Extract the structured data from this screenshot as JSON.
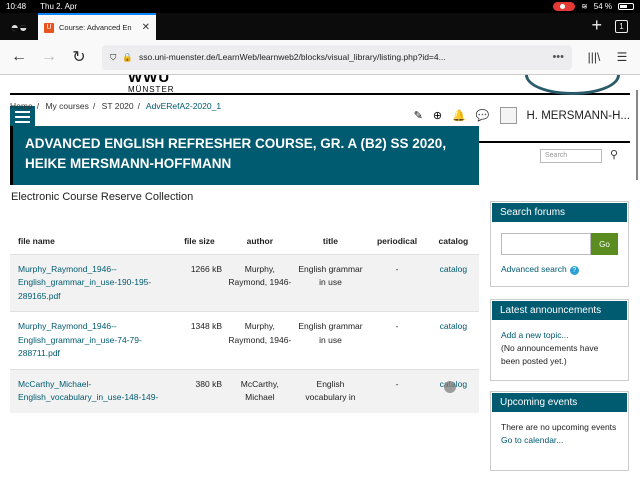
{
  "status_bar": {
    "time": "10:48",
    "date": "Thu 2. Apr",
    "battery": "54 %"
  },
  "browser": {
    "tab_title": "Course: Advanced En",
    "favicon_letter": "U",
    "tab_count": "1",
    "url": "sso.uni-muenster.de/LearnWeb/learnweb2/blocks/visual_library/listing.php?id=4..."
  },
  "header": {
    "wwu": "WWU",
    "muenster": "MÜNSTER",
    "user_name": "H. MERSMANN-H...",
    "search_placeholder": "Search"
  },
  "breadcrumb": [
    "Home",
    "My courses",
    "ST 2020",
    "AdvERefA2-2020_1"
  ],
  "course_title": "ADVANCED ENGLISH REFRESHER COURSE, GR. A (B2) SS 2020, HEIKE MERSMANN-HOFFMANN",
  "section_title": "Electronic Course Reserve Collection",
  "table": {
    "headers": [
      "file name",
      "file size",
      "author",
      "title",
      "periodical",
      "catalog"
    ],
    "rows": [
      {
        "file": "Murphy_Raymond_1946--English_grammar_in_use-190-195-289165.pdf",
        "size": "1266 kB",
        "author": "Murphy, Raymond, 1946-",
        "title": "English grammar in use",
        "periodical": "-",
        "catalog": "catalog"
      },
      {
        "file": "Murphy_Raymond_1946--English_grammar_in_use-74-79-288711.pdf",
        "size": "1348 kB",
        "author": "Murphy, Raymond, 1946-",
        "title": "English grammar in use",
        "periodical": "-",
        "catalog": "catalog"
      },
      {
        "file": "McCarthy_Michael-English_vocabulary_in_use-148-149-",
        "size": "380 kB",
        "author": "McCarthy, Michael",
        "title": "English vocabulary in",
        "periodical": "-",
        "catalog": "catalog"
      }
    ]
  },
  "sidebar": {
    "search_forums": {
      "title": "Search forums",
      "go": "Go",
      "advanced": "Advanced search"
    },
    "announcements": {
      "title": "Latest announcements",
      "add": "Add a new topic...",
      "note": "(No announcements have been posted yet.)"
    },
    "events": {
      "title": "Upcoming events",
      "note": "There are no upcoming events",
      "link": "Go to calendar..."
    }
  }
}
